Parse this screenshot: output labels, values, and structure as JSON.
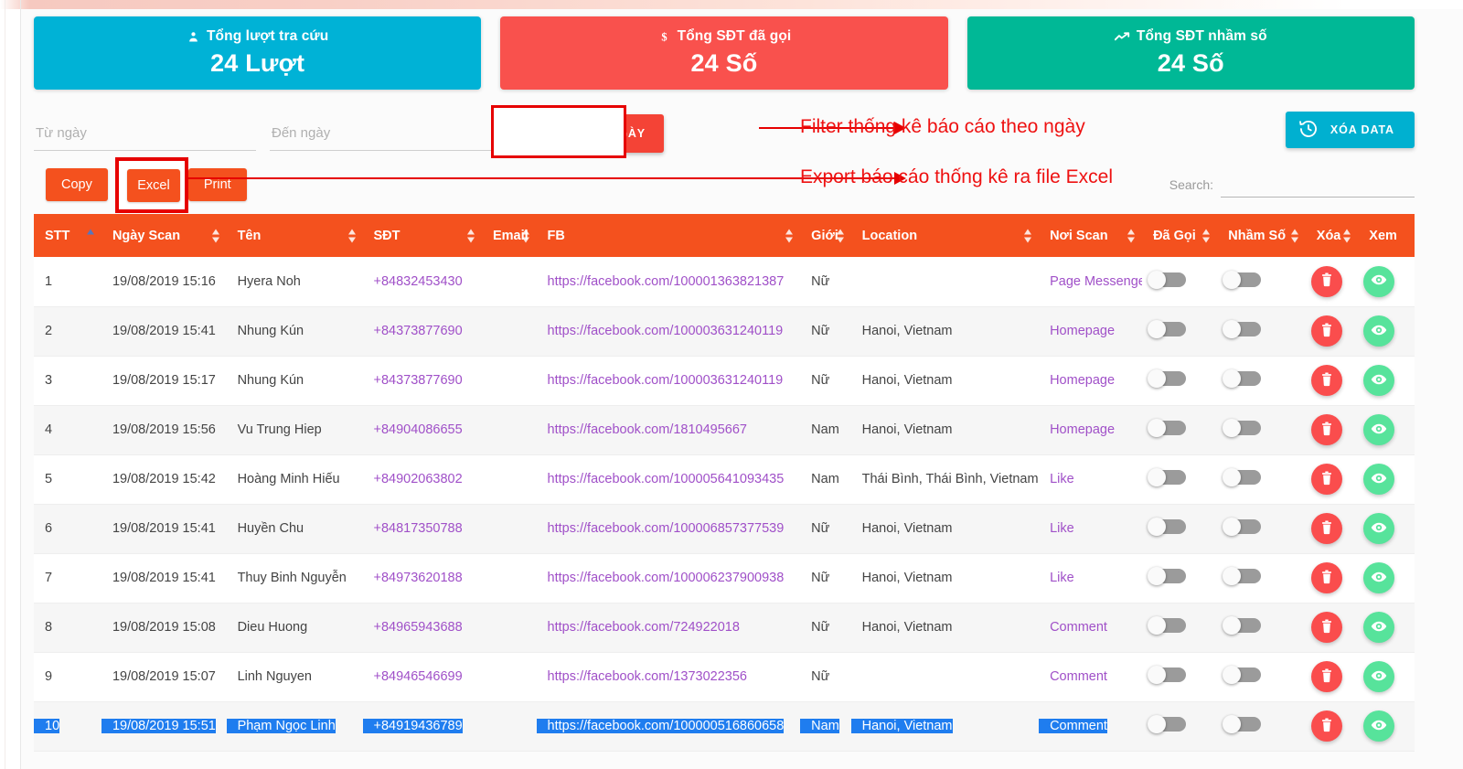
{
  "cards": [
    {
      "id": "luot-tra-cuu",
      "icon": "person-icon",
      "label": "Tổng lượt tra cứu",
      "value": "24 Lượt",
      "color": "#00b2d6"
    },
    {
      "id": "sdt-da-goi",
      "icon": "dollar-icon",
      "label": "Tổng SĐT đã gọi",
      "value": "24 Số",
      "color": "#f9514d"
    },
    {
      "id": "sdt-nham-so",
      "icon": "trending-up-icon",
      "label": "Tổng SĐT nhầm số",
      "value": "24 Số",
      "color": "#00b896"
    }
  ],
  "filter": {
    "from_placeholder": "Từ ngày",
    "from_value": "",
    "to_placeholder": "Đến ngày",
    "to_value": "",
    "find_label": "TÌM THEO NGÀY",
    "clear_label": "XÓA DATA"
  },
  "export": {
    "copy_label": "Copy",
    "excel_label": "Excel",
    "print_label": "Print"
  },
  "search": {
    "label": "Search:",
    "value": "",
    "placeholder": ""
  },
  "annotations": [
    {
      "id": "filter-note",
      "text": "Filter thống kê báo cáo theo ngày"
    },
    {
      "id": "export-note",
      "text": "Export báo cáo thống kê ra file Excel"
    }
  ],
  "table": {
    "columns": [
      {
        "key": "stt",
        "label": "STT",
        "sort": "asc"
      },
      {
        "key": "ngay_scan",
        "label": "Ngày Scan",
        "sort": "none"
      },
      {
        "key": "ten",
        "label": "Tên",
        "sort": "none"
      },
      {
        "key": "sdt",
        "label": "SĐT",
        "sort": "none"
      },
      {
        "key": "email",
        "label": "Email",
        "sort": "none"
      },
      {
        "key": "fb",
        "label": "FB",
        "sort": "none"
      },
      {
        "key": "gioi",
        "label": "Giới",
        "sort": "none"
      },
      {
        "key": "location",
        "label": "Location",
        "sort": "none"
      },
      {
        "key": "noi_scan",
        "label": "Nơi Scan",
        "sort": "none"
      },
      {
        "key": "da_goi",
        "label": "Đã Gọi",
        "sort": "none"
      },
      {
        "key": "nham_so",
        "label": "Nhầm Số",
        "sort": "none"
      },
      {
        "key": "xoa",
        "label": "Xóa",
        "sort": "none"
      },
      {
        "key": "xem",
        "label": "Xem",
        "sort": "none"
      }
    ],
    "rows": [
      {
        "stt": "1",
        "ngay_scan": "19/08/2019 15:16",
        "ten": "Hyera Noh",
        "sdt": "+84832453430",
        "email": "",
        "fb": "https://facebook.com/100001363821387",
        "gioi": "Nữ",
        "location": "",
        "noi_scan": "Page Messenger",
        "da_goi": false,
        "nham_so": false,
        "selected": false
      },
      {
        "stt": "2",
        "ngay_scan": "19/08/2019 15:41",
        "ten": "Nhung Kún",
        "sdt": "+84373877690",
        "email": "",
        "fb": "https://facebook.com/100003631240119",
        "gioi": "Nữ",
        "location": "Hanoi, Vietnam",
        "noi_scan": "Homepage",
        "da_goi": false,
        "nham_so": false,
        "selected": false
      },
      {
        "stt": "3",
        "ngay_scan": "19/08/2019 15:17",
        "ten": "Nhung Kún",
        "sdt": "+84373877690",
        "email": "",
        "fb": "https://facebook.com/100003631240119",
        "gioi": "Nữ",
        "location": "Hanoi, Vietnam",
        "noi_scan": "Homepage",
        "da_goi": false,
        "nham_so": false,
        "selected": false
      },
      {
        "stt": "4",
        "ngay_scan": "19/08/2019 15:56",
        "ten": "Vu Trung Hiep",
        "sdt": "+84904086655",
        "email": "",
        "fb": "https://facebook.com/1810495667",
        "gioi": "Nam",
        "location": "Hanoi, Vietnam",
        "noi_scan": "Homepage",
        "da_goi": false,
        "nham_so": false,
        "selected": false
      },
      {
        "stt": "5",
        "ngay_scan": "19/08/2019 15:42",
        "ten": "Hoàng Minh Hiếu",
        "sdt": "+84902063802",
        "email": "",
        "fb": "https://facebook.com/100005641093435",
        "gioi": "Nam",
        "location": "Thái Bình, Thái Bình, Vietnam",
        "noi_scan": "Like",
        "da_goi": false,
        "nham_so": false,
        "selected": false
      },
      {
        "stt": "6",
        "ngay_scan": "19/08/2019 15:41",
        "ten": "Huyền Chu",
        "sdt": "+84817350788",
        "email": "",
        "fb": "https://facebook.com/100006857377539",
        "gioi": "Nữ",
        "location": "Hanoi, Vietnam",
        "noi_scan": "Like",
        "da_goi": false,
        "nham_so": false,
        "selected": false
      },
      {
        "stt": "7",
        "ngay_scan": "19/08/2019 15:41",
        "ten": "Thuy Binh Nguyễn",
        "sdt": "+84973620188",
        "email": "",
        "fb": "https://facebook.com/100006237900938",
        "gioi": "Nữ",
        "location": "Hanoi, Vietnam",
        "noi_scan": "Like",
        "da_goi": false,
        "nham_so": false,
        "selected": false
      },
      {
        "stt": "8",
        "ngay_scan": "19/08/2019 15:08",
        "ten": "Dieu Huong",
        "sdt": "+84965943688",
        "email": "",
        "fb": "https://facebook.com/724922018",
        "gioi": "Nữ",
        "location": "Hanoi, Vietnam",
        "noi_scan": "Comment",
        "da_goi": false,
        "nham_so": false,
        "selected": false
      },
      {
        "stt": "9",
        "ngay_scan": "19/08/2019 15:07",
        "ten": "Linh Nguyen",
        "sdt": "+84946546699",
        "email": "",
        "fb": "https://facebook.com/1373022356",
        "gioi": "Nữ",
        "location": "",
        "noi_scan": "Comment",
        "da_goi": false,
        "nham_so": false,
        "selected": false
      },
      {
        "stt": "10",
        "ngay_scan": "19/08/2019 15:51",
        "ten": "Phạm Ngọc Linh",
        "sdt": "+84919436789",
        "email": "",
        "fb": "https://facebook.com/100000516860658",
        "gioi": "Nam",
        "location": "Hanoi, Vietnam",
        "noi_scan": "Comment",
        "da_goi": false,
        "nham_so": false,
        "selected": true
      }
    ]
  }
}
